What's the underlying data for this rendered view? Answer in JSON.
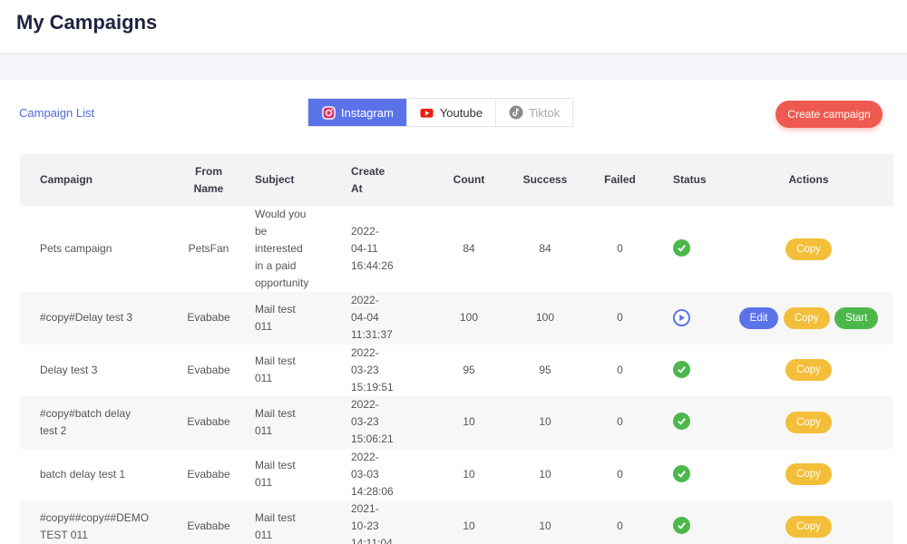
{
  "page": {
    "title": "My Campaigns"
  },
  "toolbar": {
    "campaign_list_label": "Campaign List",
    "create_label": "Create campaign",
    "tabs": [
      {
        "label": "Instagram",
        "icon": "instagram-icon",
        "active": true
      },
      {
        "label": "Youtube",
        "icon": "youtube-icon",
        "active": false
      },
      {
        "label": "Tiktok",
        "icon": "tiktok-icon",
        "active": false,
        "disabled": true
      }
    ]
  },
  "table": {
    "headers": {
      "campaign": "Campaign",
      "from_line1": "From",
      "from_line2": "Name",
      "subject": "Subject",
      "create_line1": "Create",
      "create_line2": "At",
      "count": "Count",
      "success": "Success",
      "failed": "Failed",
      "status": "Status",
      "actions": "Actions"
    },
    "rows": [
      {
        "campaign_lines": [
          "Pets campaign"
        ],
        "from": "PetsFan",
        "subject_lines": [
          "Would you",
          "be",
          "interested",
          "in a paid",
          "opportunity"
        ],
        "date_lines": [
          "2022-",
          "04-11",
          "16:44:26"
        ],
        "count": "84",
        "success": "84",
        "failed": "0",
        "status": "completed",
        "actions": [
          "Copy"
        ]
      },
      {
        "campaign_lines": [
          "#copy#Delay test 3"
        ],
        "from": "Evababe",
        "subject_lines": [
          "Mail test",
          "011"
        ],
        "date_lines": [
          "2022-",
          "04-04",
          "11:31:37"
        ],
        "count": "100",
        "success": "100",
        "failed": "0",
        "status": "paused",
        "actions": [
          "Edit",
          "Copy",
          "Start"
        ]
      },
      {
        "campaign_lines": [
          "Delay test 3"
        ],
        "from": "Evababe",
        "subject_lines": [
          "Mail test",
          "011"
        ],
        "date_lines": [
          "2022-",
          "03-23",
          "15:19:51"
        ],
        "count": "95",
        "success": "95",
        "failed": "0",
        "status": "completed",
        "actions": [
          "Copy"
        ]
      },
      {
        "campaign_lines": [
          "#copy#batch delay",
          "test 2"
        ],
        "from": "Evababe",
        "subject_lines": [
          "Mail test",
          "011"
        ],
        "date_lines": [
          "2022-",
          "03-23",
          "15:06:21"
        ],
        "count": "10",
        "success": "10",
        "failed": "0",
        "status": "completed",
        "actions": [
          "Copy"
        ]
      },
      {
        "campaign_lines": [
          "batch delay test 1"
        ],
        "from": "Evababe",
        "subject_lines": [
          "Mail test",
          "011"
        ],
        "date_lines": [
          "2022-",
          "03-03",
          "14:28:06"
        ],
        "count": "10",
        "success": "10",
        "failed": "0",
        "status": "completed",
        "actions": [
          "Copy"
        ]
      },
      {
        "campaign_lines": [
          "#copy##copy##DEMO",
          "TEST 011"
        ],
        "from": "Evababe",
        "subject_lines": [
          "Mail test",
          "011"
        ],
        "date_lines": [
          "2021-",
          "10-23",
          "14:11:04"
        ],
        "count": "10",
        "success": "10",
        "failed": "0",
        "status": "completed",
        "actions": [
          "Copy"
        ]
      }
    ]
  },
  "colors": {
    "accent": "#5b73e8",
    "create": "#ee5a4f",
    "copy": "#f3bf3a",
    "success": "#4cb84c"
  }
}
